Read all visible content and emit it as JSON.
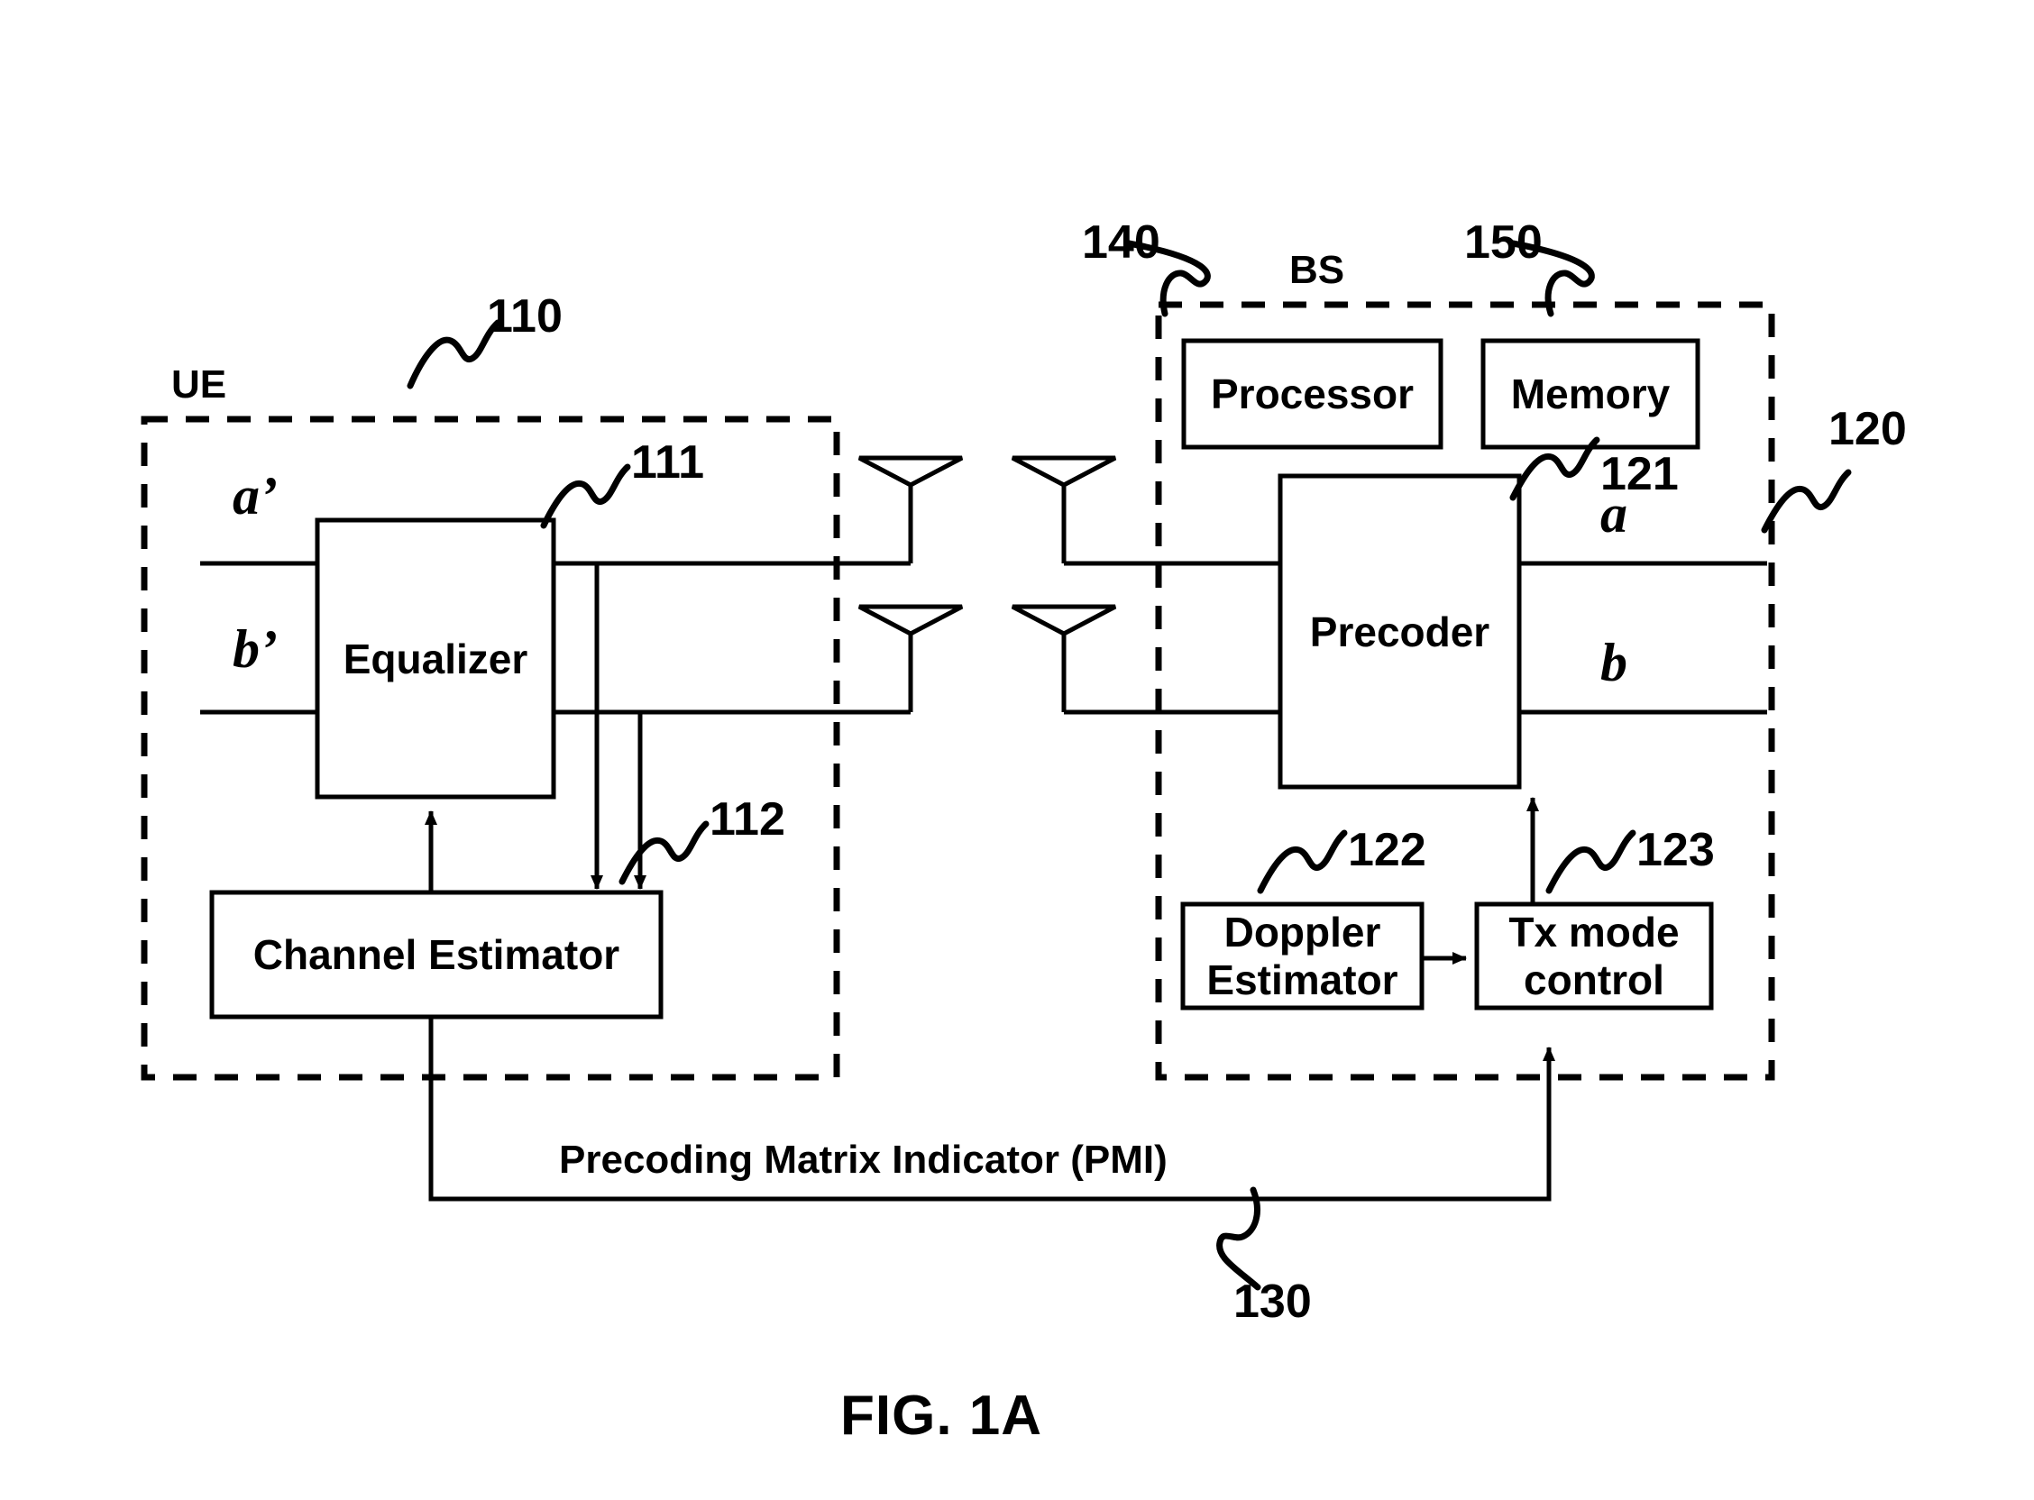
{
  "figure": {
    "caption": "FIG. 1A",
    "background_color": "#ffffff",
    "line_color": "#000000"
  },
  "enclosures": {
    "ue": {
      "tag": "UE",
      "ref": "110"
    },
    "bs": {
      "tag": "BS",
      "ref": "120"
    }
  },
  "ue_side": {
    "signals": {
      "a_prime": "a’",
      "b_prime": "b’"
    },
    "blocks": [
      {
        "label": "Equalizer",
        "ref": "111"
      },
      {
        "label": "Channel Estimator",
        "ref": "112"
      }
    ]
  },
  "bs_side": {
    "signals": {
      "a": "a",
      "b": "b"
    },
    "blocks": [
      {
        "label": "Processor",
        "ref": "140"
      },
      {
        "label": "Memory",
        "ref": "150"
      },
      {
        "label": "Precoder",
        "ref": "121"
      },
      {
        "label_line1": "Doppler",
        "label_line2": "Estimator",
        "ref": "122"
      },
      {
        "label_line1": "Tx mode",
        "label_line2": "control",
        "ref": "123"
      }
    ]
  },
  "feedback": {
    "label": "Precoding Matrix Indicator (PMI)",
    "ref": "130"
  },
  "icons": {
    "antenna": "antenna-icon",
    "lead_line": "reference-lead-line"
  }
}
